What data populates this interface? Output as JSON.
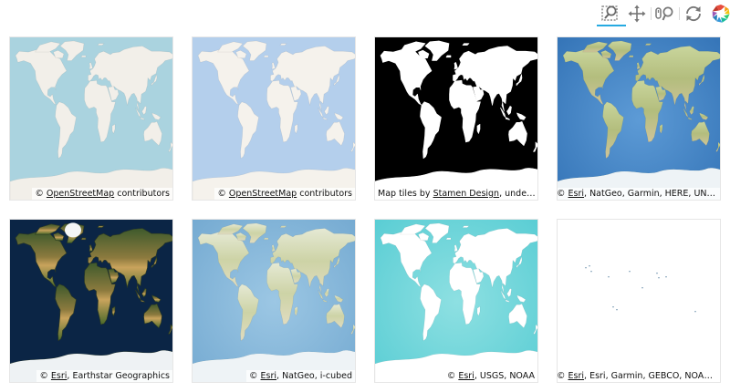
{
  "toolbar": {
    "tools": [
      {
        "name": "box-zoom",
        "active": true
      },
      {
        "name": "pan",
        "active": false
      },
      {
        "name": "wheel-zoom",
        "active": false
      },
      {
        "name": "reset",
        "active": false
      },
      {
        "name": "bokeh-logo",
        "active": false
      }
    ],
    "accent_color": "#26aae1"
  },
  "tiles": [
    {
      "style": "light",
      "ocean": "#aad3df",
      "land": "#f2efe9",
      "attribution": {
        "prefix": "© ",
        "link": "OpenStreetMap",
        "suffix": " contributors"
      }
    },
    {
      "style": "blue",
      "ocean": "#b4cfec",
      "land": "#f5f2ec",
      "attribution": {
        "prefix": "© ",
        "link": "OpenStreetMap",
        "suffix": " contributors"
      }
    },
    {
      "style": "toner",
      "ocean": "#000000",
      "land": "#ffffff",
      "attribution": {
        "prefix": "Map tiles by ",
        "link": "Stamen Design",
        "suffix": ", under ..."
      }
    },
    {
      "style": "natgeo",
      "ocean": "#3e7fc0",
      "land": "#b9c584",
      "attribution": {
        "prefix": "© ",
        "link": "Esri",
        "suffix": ", NatGeo, Garmin, HERE, UNE..."
      }
    },
    {
      "style": "imagery",
      "ocean": "#0b2545",
      "land": "#6b7a3e",
      "attribution": {
        "prefix": "© ",
        "link": "Esri",
        "suffix": ", Earthstar Geographics"
      }
    },
    {
      "style": "natgeo-light",
      "ocean": "#7fb3d6",
      "land": "#d8dcc0",
      "attribution": {
        "prefix": "© ",
        "link": "Esri",
        "suffix": ", NatGeo, i-cubed"
      }
    },
    {
      "style": "ocean-teal",
      "ocean": "#67d3d8",
      "land": "#ffffff",
      "attribution": {
        "prefix": "© ",
        "link": "Esri",
        "suffix": ", USGS, NOAA"
      }
    },
    {
      "style": "sparse",
      "ocean": "#ffffff",
      "land": "#ffffff",
      "attribution": {
        "prefix": "© ",
        "link": "Esri",
        "suffix": ", Esri, Garmin, GEBCO, NOAA,..."
      }
    }
  ]
}
